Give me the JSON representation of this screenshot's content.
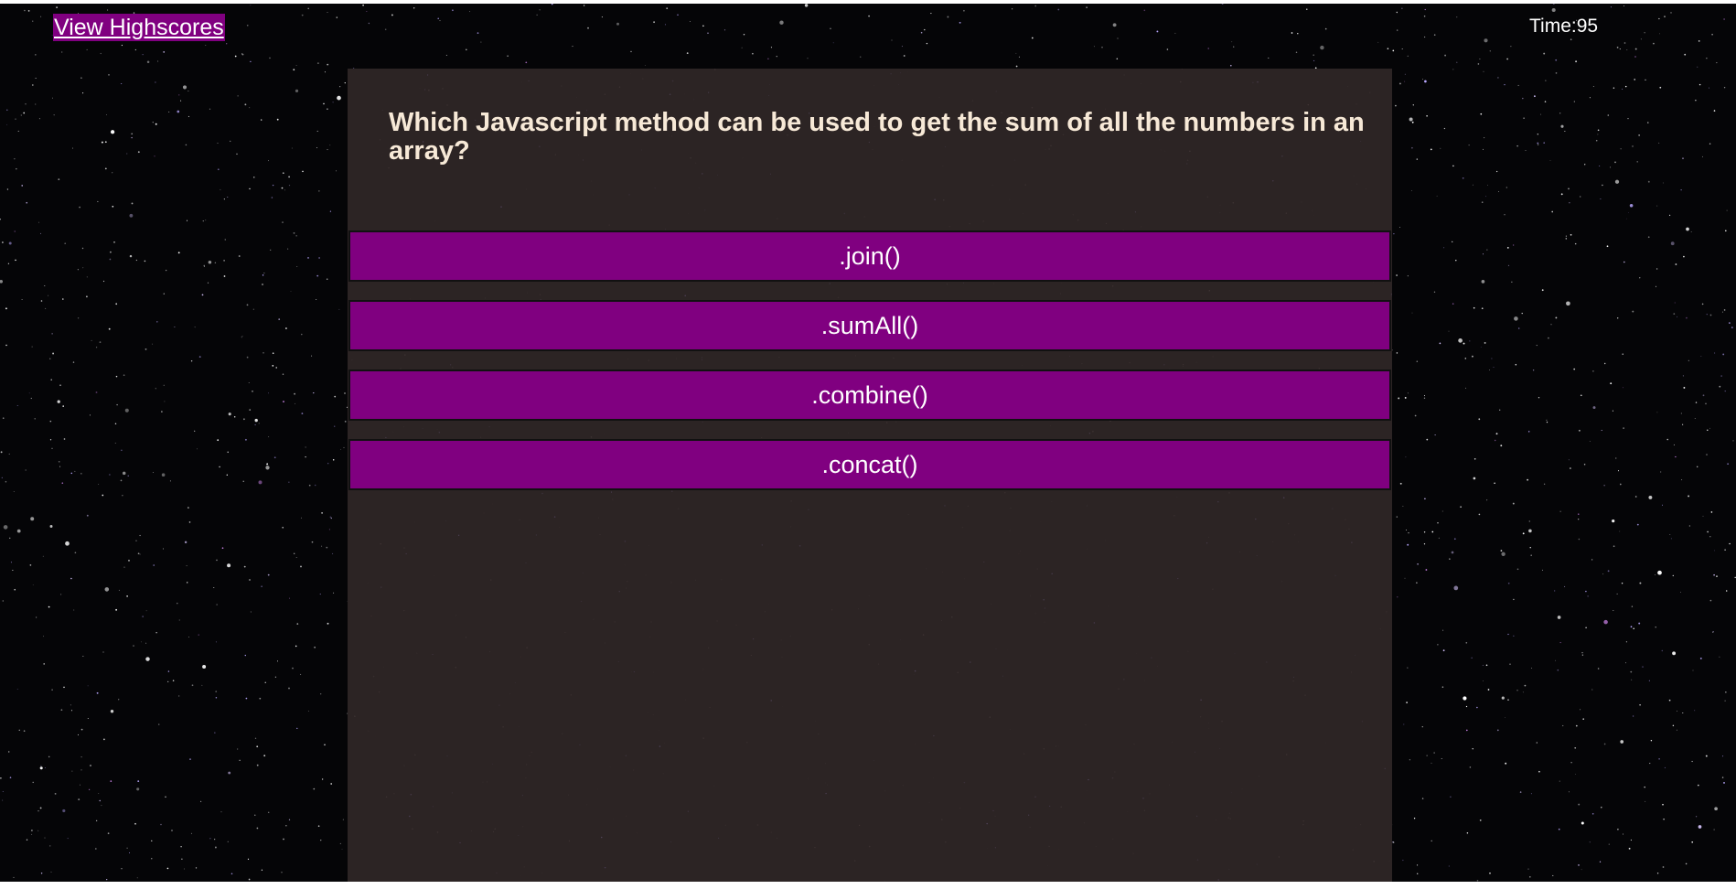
{
  "header": {
    "highscores_label": "View Highscores",
    "timer_text": "Time:95"
  },
  "quiz": {
    "question": "Which Javascript method can be used to get the sum of all the numbers in an array?",
    "answers": [
      ".join()",
      ".sumAll()",
      ".combine()",
      ".concat()"
    ]
  },
  "colors": {
    "accent": "#800080",
    "panel": "#2c2424",
    "question_text": "#f7e9d7",
    "background": "#050507"
  }
}
